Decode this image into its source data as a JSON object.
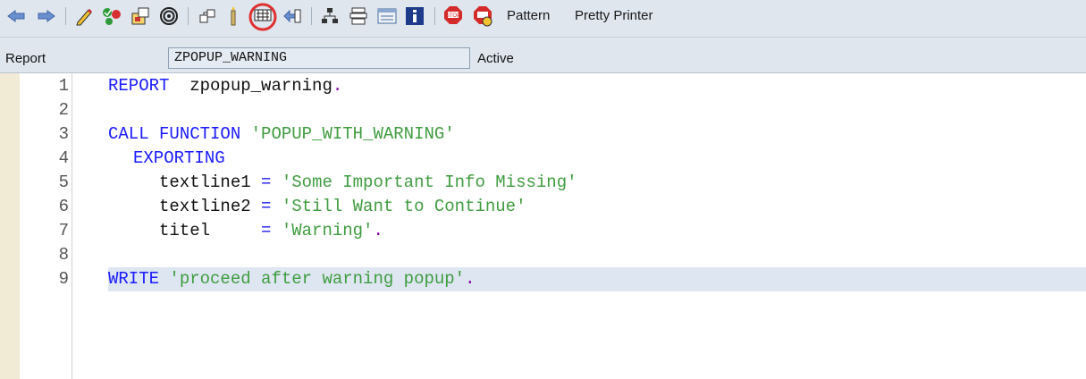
{
  "toolbar": {
    "icons": [
      "back-arrow-icon",
      "forward-arrow-icon",
      "edit-pencil-icon",
      "check-icon",
      "activate-icon",
      "test-spiral-icon",
      "object-list-icon",
      "where-used-icon",
      "insert-statement-icon",
      "navigate-icon",
      "hierarchy-icon",
      "display-object-list-icon",
      "screen-icon",
      "info-icon",
      "breakpoint-stop-icon",
      "external-breakpoint-icon"
    ],
    "pattern_label": "Pattern",
    "pretty_printer_label": "Pretty Printer",
    "highlight_color": "#e03030"
  },
  "header": {
    "report_label": "Report",
    "program_name": "ZPOPUP_WARNING",
    "status": "Active"
  },
  "editor": {
    "line_numbers": [
      "1",
      "2",
      "3",
      "4",
      "5",
      "6",
      "7",
      "8",
      "9"
    ],
    "lines": {
      "l1": {
        "kw": "REPORT",
        "rest": "  zpopup_warning",
        "end": "."
      },
      "l3": {
        "kw": "CALL FUNCTION",
        "str": "'POPUP_WITH_WARNING'"
      },
      "l4": {
        "kw": "EXPORTING"
      },
      "l5": {
        "name": "textline1",
        "op": "=",
        "str": "'Some Important Info Missing'"
      },
      "l6": {
        "name": "textline2",
        "op": "=",
        "str": "'Still Want to Continue'"
      },
      "l7": {
        "name": "titel",
        "op": "=",
        "str": "'Warning'",
        "end": "."
      },
      "l9": {
        "kw": "WRITE",
        "str": "'proceed after warning popup'",
        "end": "."
      }
    },
    "current_line": "9",
    "colors": {
      "keyword": "#1a1aff",
      "string": "#3f9c3f",
      "punct": "#8000a0",
      "current_line_bg": "#dde6f1",
      "gutter": "#f1ebd6"
    }
  }
}
